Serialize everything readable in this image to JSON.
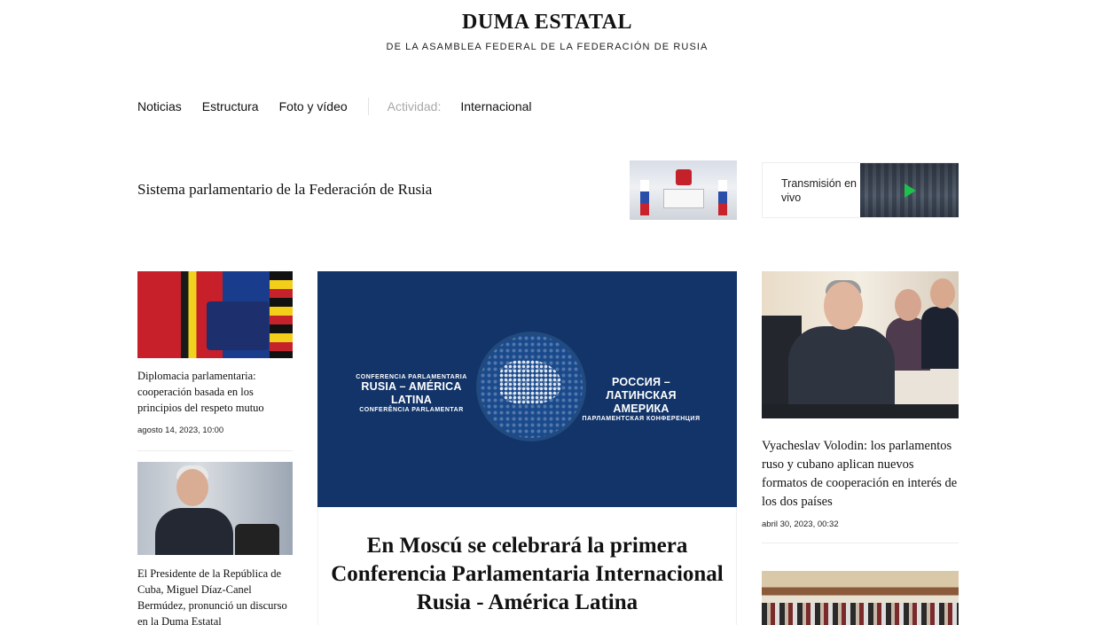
{
  "header": {
    "title": "DUMA ESTATAL",
    "subtitle": "DE LA ASAMBLEA FEDERAL DE LA FEDERACIÓN DE RUSIA"
  },
  "nav": {
    "items": [
      "Noticias",
      "Estructura",
      "Foto y vídeo"
    ],
    "activity_label": "Actividad:",
    "activity_item": "Internacional"
  },
  "promo": {
    "system_link": "Sistema parlamentario de la Federación de Rusia",
    "live_label": "Transmisión en vivo"
  },
  "left_column": [
    {
      "title": "Diplomacia parlamentaria: cooperación basada en los principios del respeto mutuo",
      "date": "agosto 14, 2023, 10:00"
    },
    {
      "title": "El Presidente de la República de Cuba, Miguel Díaz-Canel Bermúdez, pronunció un discurso en la Duma Estatal"
    }
  ],
  "feature": {
    "banner_left_small_top": "CONFERENCIA PARLAMENTARIA",
    "banner_left_big": "RUSIA – AMÉRICA LATINA",
    "banner_left_small_bottom": "CONFERÊNCIA PARLAMENTAR",
    "banner_right_big_1": "РОССИЯ –",
    "banner_right_big_2": "ЛАТИНСКАЯ АМЕРИКА",
    "banner_right_small": "ПАРЛАМЕНТСКАЯ КОНФЕРЕНЦИЯ",
    "title": "En Moscú se celebrará la primera Conferencia Parlamentaria Internacional Rusia - América Latina"
  },
  "right_column": [
    {
      "title": "Vyacheslav Volodin: los parlamentos ruso y cubano aplican nuevos formatos de cooperación en interés de los dos países",
      "date": "abril 30, 2023, 00:32"
    }
  ],
  "colors": {
    "banner_blue": "#123469",
    "live_play": "#1fbf4b",
    "muted_text": "#a8a8a8"
  }
}
